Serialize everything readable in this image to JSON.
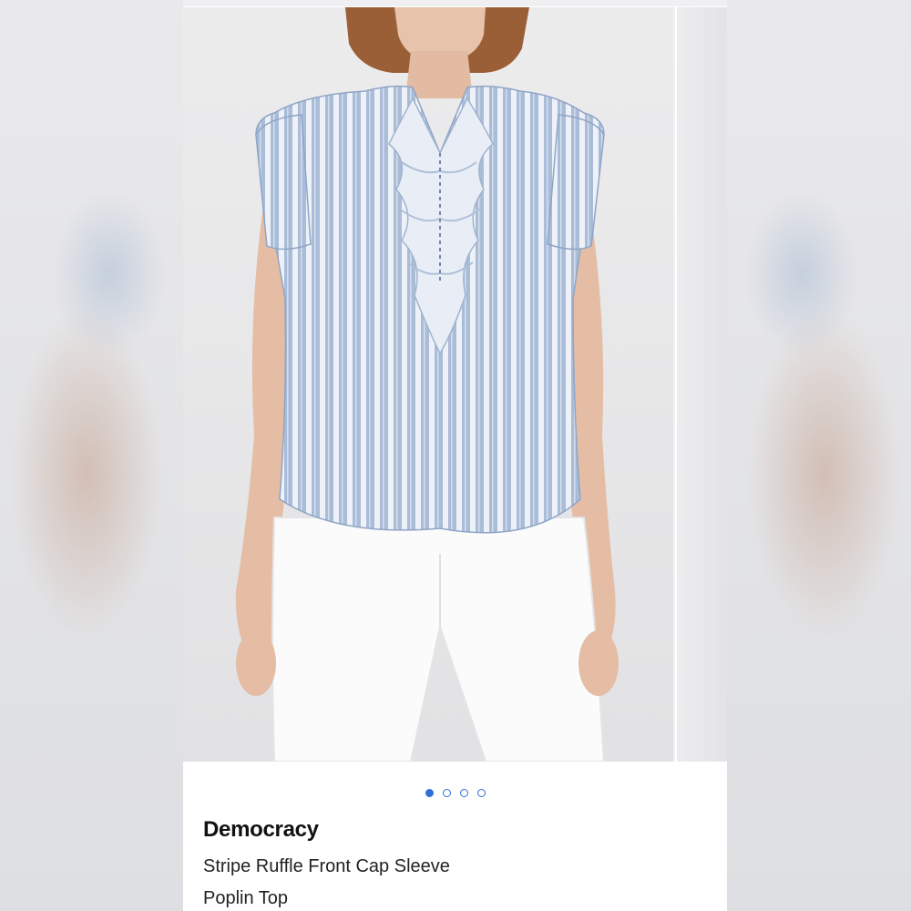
{
  "product": {
    "brand": "Democracy",
    "title_line1": "Stripe Ruffle Front Cap Sleeve",
    "title_line2": "Poplin Top",
    "image_icon": "product-photo-model-striped-top"
  },
  "gallery": {
    "image_count": 4,
    "active_index": 0,
    "dot_color": "#2f6fd6"
  },
  "colors": {
    "shirt_blue": "#a9bcd8",
    "stripe_white": "#f2f4f8",
    "page_background": "#ffffff"
  }
}
